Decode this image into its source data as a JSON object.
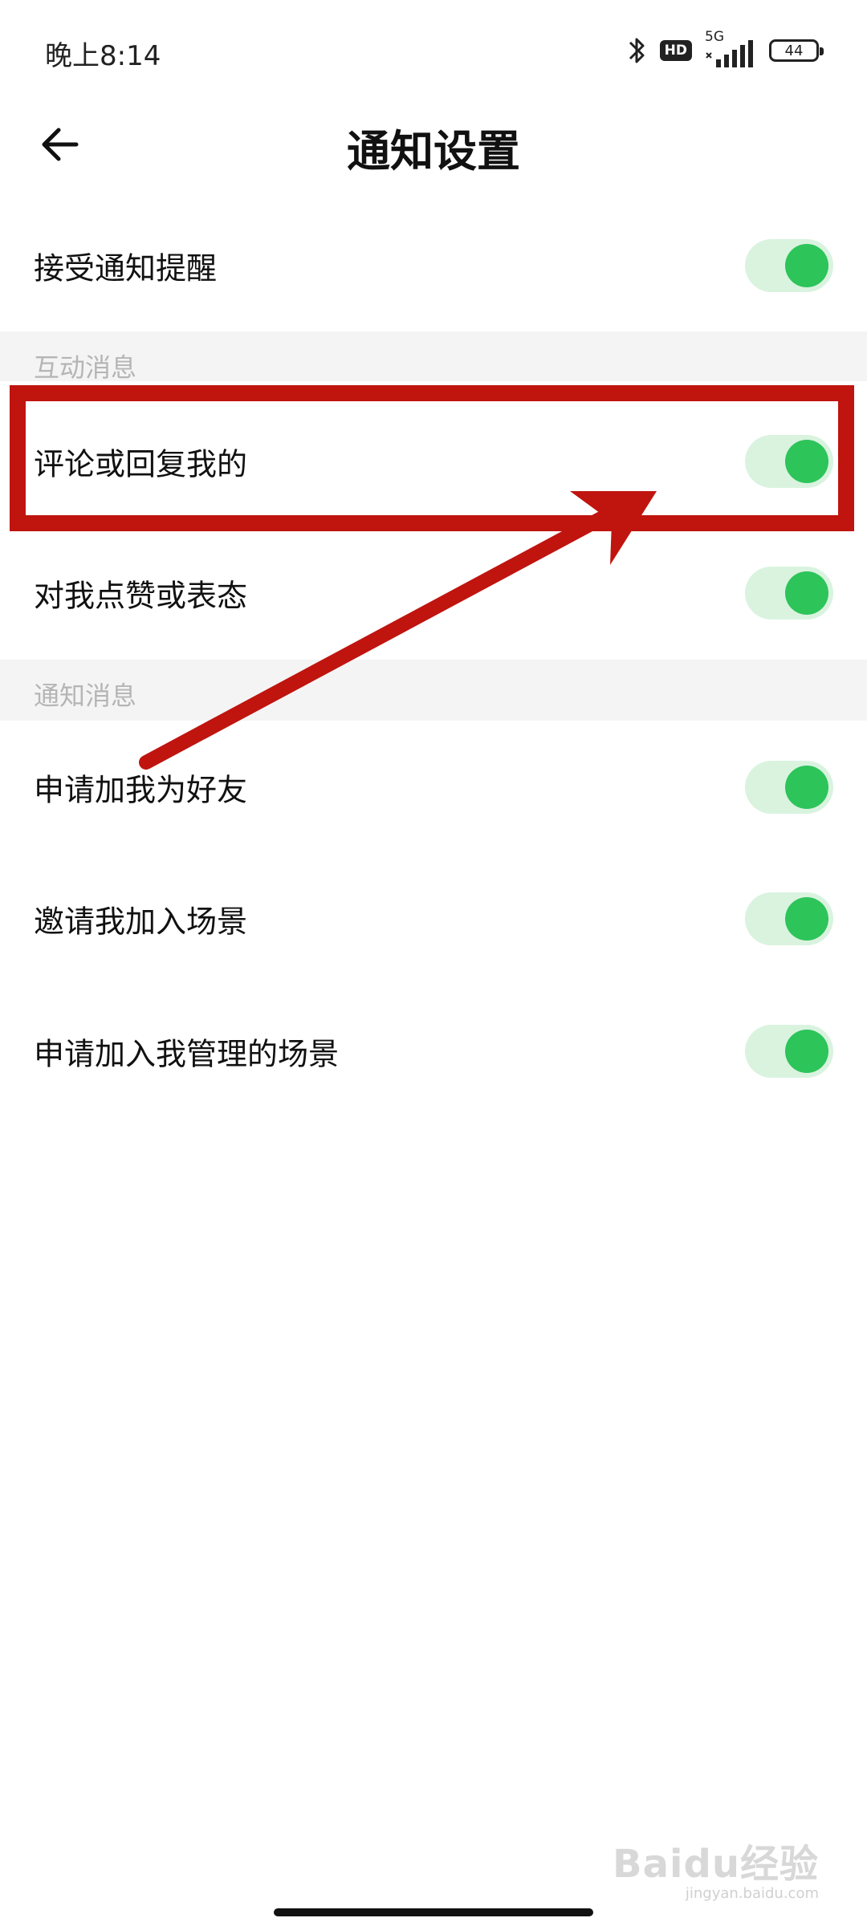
{
  "status_bar": {
    "time": "晚上8:14",
    "hd_label": "HD",
    "network_label": "5G",
    "battery_level": "44",
    "icons": [
      "bluetooth-icon",
      "hd-icon",
      "signal-icon",
      "battery-icon"
    ]
  },
  "header": {
    "back_icon": "arrow-left-icon",
    "title": "通知设置"
  },
  "settings": {
    "accept_notifications": {
      "label": "接受通知提醒",
      "enabled": true
    },
    "sections": [
      {
        "title": "互动消息",
        "items": [
          {
            "label": "评论或回复我的",
            "enabled": true
          },
          {
            "label": "对我点赞或表态",
            "enabled": true
          }
        ]
      },
      {
        "title": "通知消息",
        "items": [
          {
            "label": "申请加我为好友",
            "enabled": true
          },
          {
            "label": "邀请我加入场景",
            "enabled": true
          },
          {
            "label": "申请加入我管理的场景",
            "enabled": true
          }
        ]
      }
    ]
  },
  "colors": {
    "toggle_on_track": "#d9f3df",
    "toggle_on_knob": "#2dc45a",
    "annotation_red": "#c0140f",
    "section_bg": "#f4f4f4",
    "section_text": "#b5b5b5"
  },
  "watermark": {
    "logo": "Baidu经验",
    "url": "jingyan.baidu.com"
  }
}
